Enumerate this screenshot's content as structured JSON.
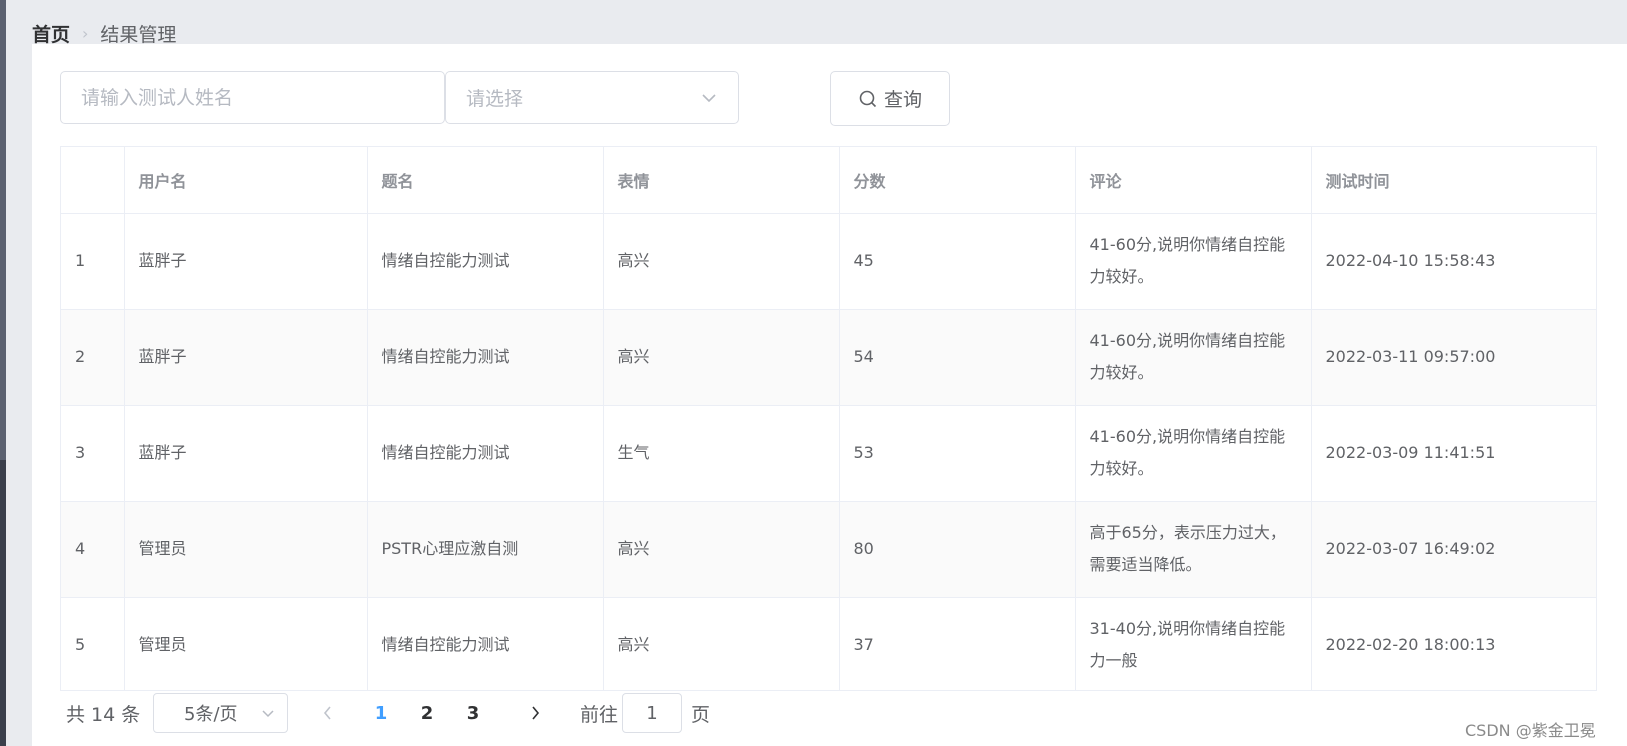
{
  "breadcrumb": {
    "home": "首页",
    "current": "结果管理"
  },
  "search": {
    "name_placeholder": "请输入测试人姓名",
    "select_placeholder": "请选择",
    "query_label": "查询"
  },
  "table": {
    "headers": [
      "",
      "用户名",
      "题名",
      "表情",
      "分数",
      "评论",
      "测试时间"
    ],
    "rows": [
      [
        "1",
        "蓝胖子",
        "情绪自控能力测试",
        "高兴",
        "45",
        "41-60分,说明你情绪自控能力较好。",
        "2022-04-10 15:58:43"
      ],
      [
        "2",
        "蓝胖子",
        "情绪自控能力测试",
        "高兴",
        "54",
        "41-60分,说明你情绪自控能力较好。",
        "2022-03-11 09:57:00"
      ],
      [
        "3",
        "蓝胖子",
        "情绪自控能力测试",
        "生气",
        "53",
        "41-60分,说明你情绪自控能力较好。",
        "2022-03-09 11:41:51"
      ],
      [
        "4",
        "管理员",
        "PSTR心理应激自测",
        "高兴",
        "80",
        "高于65分，表示压力过大，需要适当降低。",
        "2022-03-07 16:49:02"
      ],
      [
        "5",
        "管理员",
        "情绪自控能力测试",
        "高兴",
        "37",
        "31-40分,说明你情绪自控能力一般",
        "2022-02-20 18:00:13"
      ]
    ]
  },
  "pagination": {
    "total": "共 14 条",
    "page_size": "5条/页",
    "pages": [
      "1",
      "2",
      "3"
    ],
    "current_page": "1",
    "jump_prefix": "前往",
    "jump_value": "1",
    "jump_suffix": "页"
  },
  "watermark": "CSDN @紫金卫冕",
  "colors": {
    "accent": "#409eff",
    "border": "#dcdfe6",
    "header_text": "#909399",
    "body_text": "#606266",
    "stripe": "#fafafa"
  },
  "icons": {
    "search": "search-icon",
    "select_arrow": "chevron-down-icon",
    "breadcrumb_sep": "chevron-right-icon",
    "prev": "chevron-left-icon",
    "next": "chevron-right-icon"
  }
}
